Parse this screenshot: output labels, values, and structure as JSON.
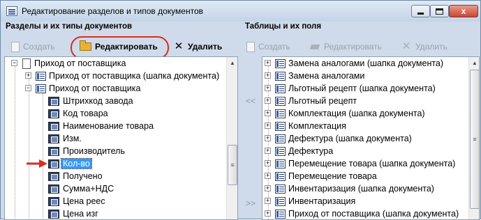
{
  "window": {
    "title": "Редактирование разделов и типов документов",
    "close_label": "x"
  },
  "left_panel": {
    "header": "Разделы и их типы документов",
    "toolbar": {
      "create_label": "Создать",
      "edit_label": "Редактировать",
      "delete_label": "Удалить"
    },
    "tree": [
      {
        "label": "Приход от поставщика",
        "level": 0,
        "expander": "minus",
        "icon": "page"
      },
      {
        "label": "Приход от поставщика (шапка документа)",
        "level": 1,
        "expander": "plus",
        "icon": "node"
      },
      {
        "label": "Приход от поставщика",
        "level": 1,
        "expander": "minus",
        "icon": "node"
      },
      {
        "label": "Штрихкод завода",
        "level": 2,
        "icon": "field"
      },
      {
        "label": "Код товара",
        "level": 2,
        "icon": "field"
      },
      {
        "label": "Наименование  товара",
        "level": 2,
        "icon": "field"
      },
      {
        "label": "Изм.",
        "level": 2,
        "icon": "field"
      },
      {
        "label": "Производитель",
        "level": 2,
        "icon": "field"
      },
      {
        "label": "Кол-во",
        "level": 2,
        "icon": "field",
        "selected": true
      },
      {
        "label": "Получено",
        "level": 2,
        "icon": "field"
      },
      {
        "label": "Сумма+НДС",
        "level": 2,
        "icon": "field"
      },
      {
        "label": "Цена реес",
        "level": 2,
        "icon": "field"
      },
      {
        "label": "Цена изг",
        "level": 2,
        "icon": "field"
      }
    ]
  },
  "transfer": {
    "left_label": "<<",
    "right_label": ">>"
  },
  "right_panel": {
    "header": "Таблицы и их поля",
    "toolbar": {
      "create_label": "Создать",
      "edit_label": "Редактировать",
      "delete_label": "Удалить"
    },
    "tree": [
      {
        "label": "Замена аналогами (шапка документа)"
      },
      {
        "label": "Замена аналогами"
      },
      {
        "label": "Льготный рецепт (шапка документа)"
      },
      {
        "label": "Льготный рецепт"
      },
      {
        "label": "Комплектация (шапка документа)"
      },
      {
        "label": "Комплектация"
      },
      {
        "label": "Дефектура (шапка документа)"
      },
      {
        "label": "Дефектура"
      },
      {
        "label": "Перемещение товара (шапка документа)"
      },
      {
        "label": "Перемещение товара"
      },
      {
        "label": "Инвентаризация (шапка документа)"
      },
      {
        "label": "Инвентаризация"
      },
      {
        "label": "Приход от поставщика (шапка документа)"
      }
    ]
  },
  "colors": {
    "highlight": "#d92d20",
    "selection": "#3399ff",
    "window_bg": "#cfdbea"
  }
}
